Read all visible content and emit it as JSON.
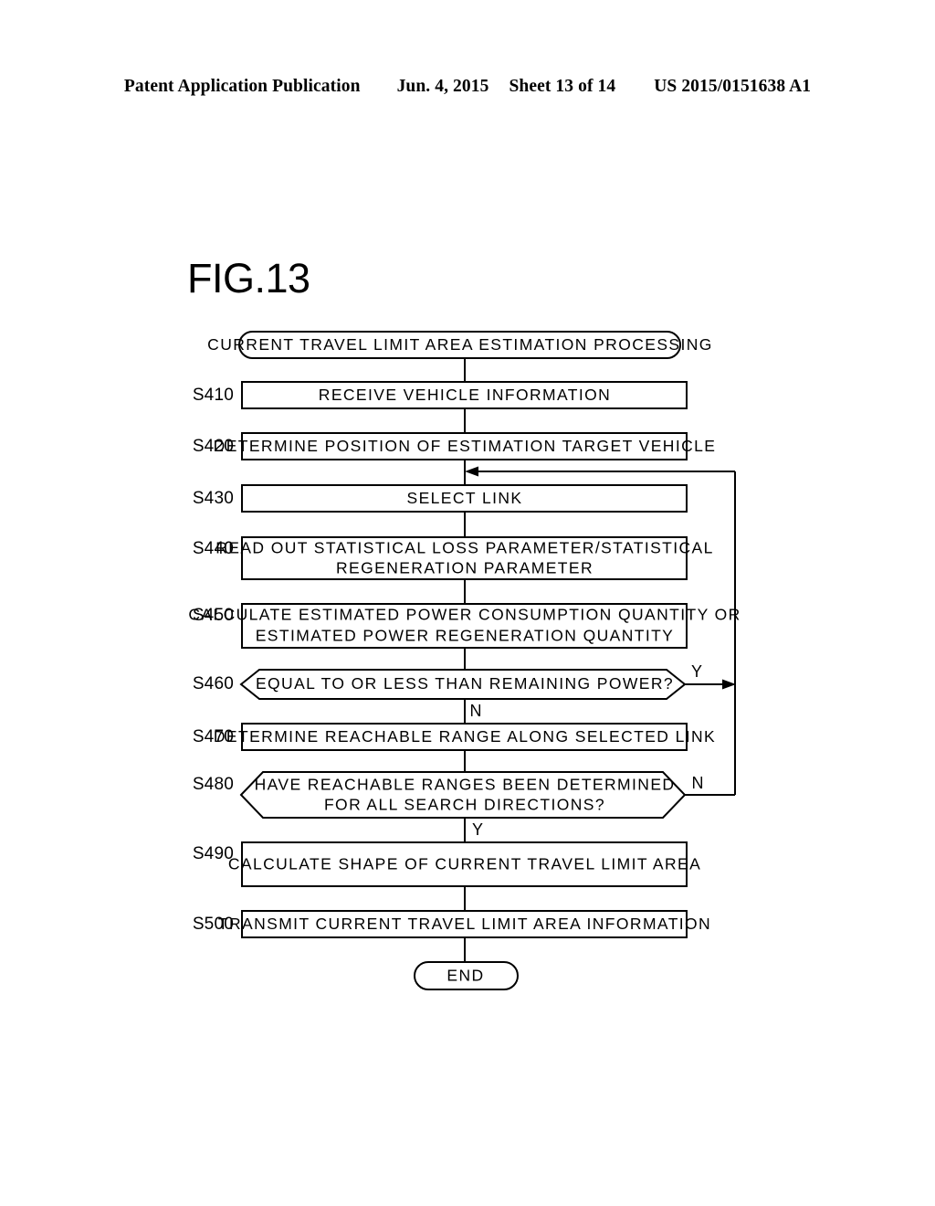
{
  "header": {
    "publication": "Patent Application Publication",
    "date": "Jun. 4, 2015",
    "sheet": "Sheet 13 of 14",
    "patent_number": "US 2015/0151638 A1"
  },
  "figure": {
    "label": "FIG.13"
  },
  "flowchart": {
    "start": {
      "id": "start",
      "shape": "terminator",
      "text": "CURRENT TRAVEL LIMIT AREA ESTIMATION PROCESSING"
    },
    "end": {
      "id": "end",
      "shape": "terminator",
      "text": "END"
    },
    "steps": [
      {
        "id": "s410",
        "step": "S410",
        "shape": "process",
        "lines": [
          "RECEIVE VEHICLE INFORMATION"
        ]
      },
      {
        "id": "s420",
        "step": "S420",
        "shape": "process",
        "lines": [
          "DETERMINE POSITION OF ESTIMATION TARGET VEHICLE"
        ]
      },
      {
        "id": "s430",
        "step": "S430",
        "shape": "process",
        "lines": [
          "SELECT LINK"
        ]
      },
      {
        "id": "s440",
        "step": "S440",
        "shape": "process",
        "lines": [
          "READ OUT STATISTICAL LOSS PARAMETER/STATISTICAL",
          "REGENERATION PARAMETER"
        ]
      },
      {
        "id": "s450",
        "step": "S450",
        "shape": "process",
        "lines": [
          "CALCULATE ESTIMATED POWER CONSUMPTION QUANTITY OR",
          "ESTIMATED POWER REGENERATION QUANTITY"
        ]
      },
      {
        "id": "s460",
        "step": "S460",
        "shape": "decision",
        "lines": [
          "EQUAL TO OR LESS THAN REMAINING POWER?"
        ],
        "branch_right": "Y",
        "branch_down": "N"
      },
      {
        "id": "s470",
        "step": "S470",
        "shape": "process",
        "lines": [
          "DETERMINE REACHABLE RANGE ALONG SELECTED LINK"
        ]
      },
      {
        "id": "s480",
        "step": "S480",
        "shape": "decision",
        "lines": [
          "HAVE REACHABLE RANGES BEEN DETERMINED",
          "FOR ALL SEARCH DIRECTIONS?"
        ],
        "branch_right": "N",
        "branch_down": "Y"
      },
      {
        "id": "s490",
        "step": "S490",
        "shape": "process",
        "lines": [
          "CALCULATE SHAPE OF CURRENT TRAVEL LIMIT AREA"
        ]
      },
      {
        "id": "s500",
        "step": "S500",
        "shape": "process",
        "lines": [
          "TRANSMIT CURRENT TRAVEL LIMIT AREA INFORMATION"
        ]
      }
    ],
    "loop_note": "Y branch of S460 and N branch of S480 both return to the line above S430"
  },
  "colors": {
    "ink": "#000000",
    "paper": "#ffffff"
  }
}
